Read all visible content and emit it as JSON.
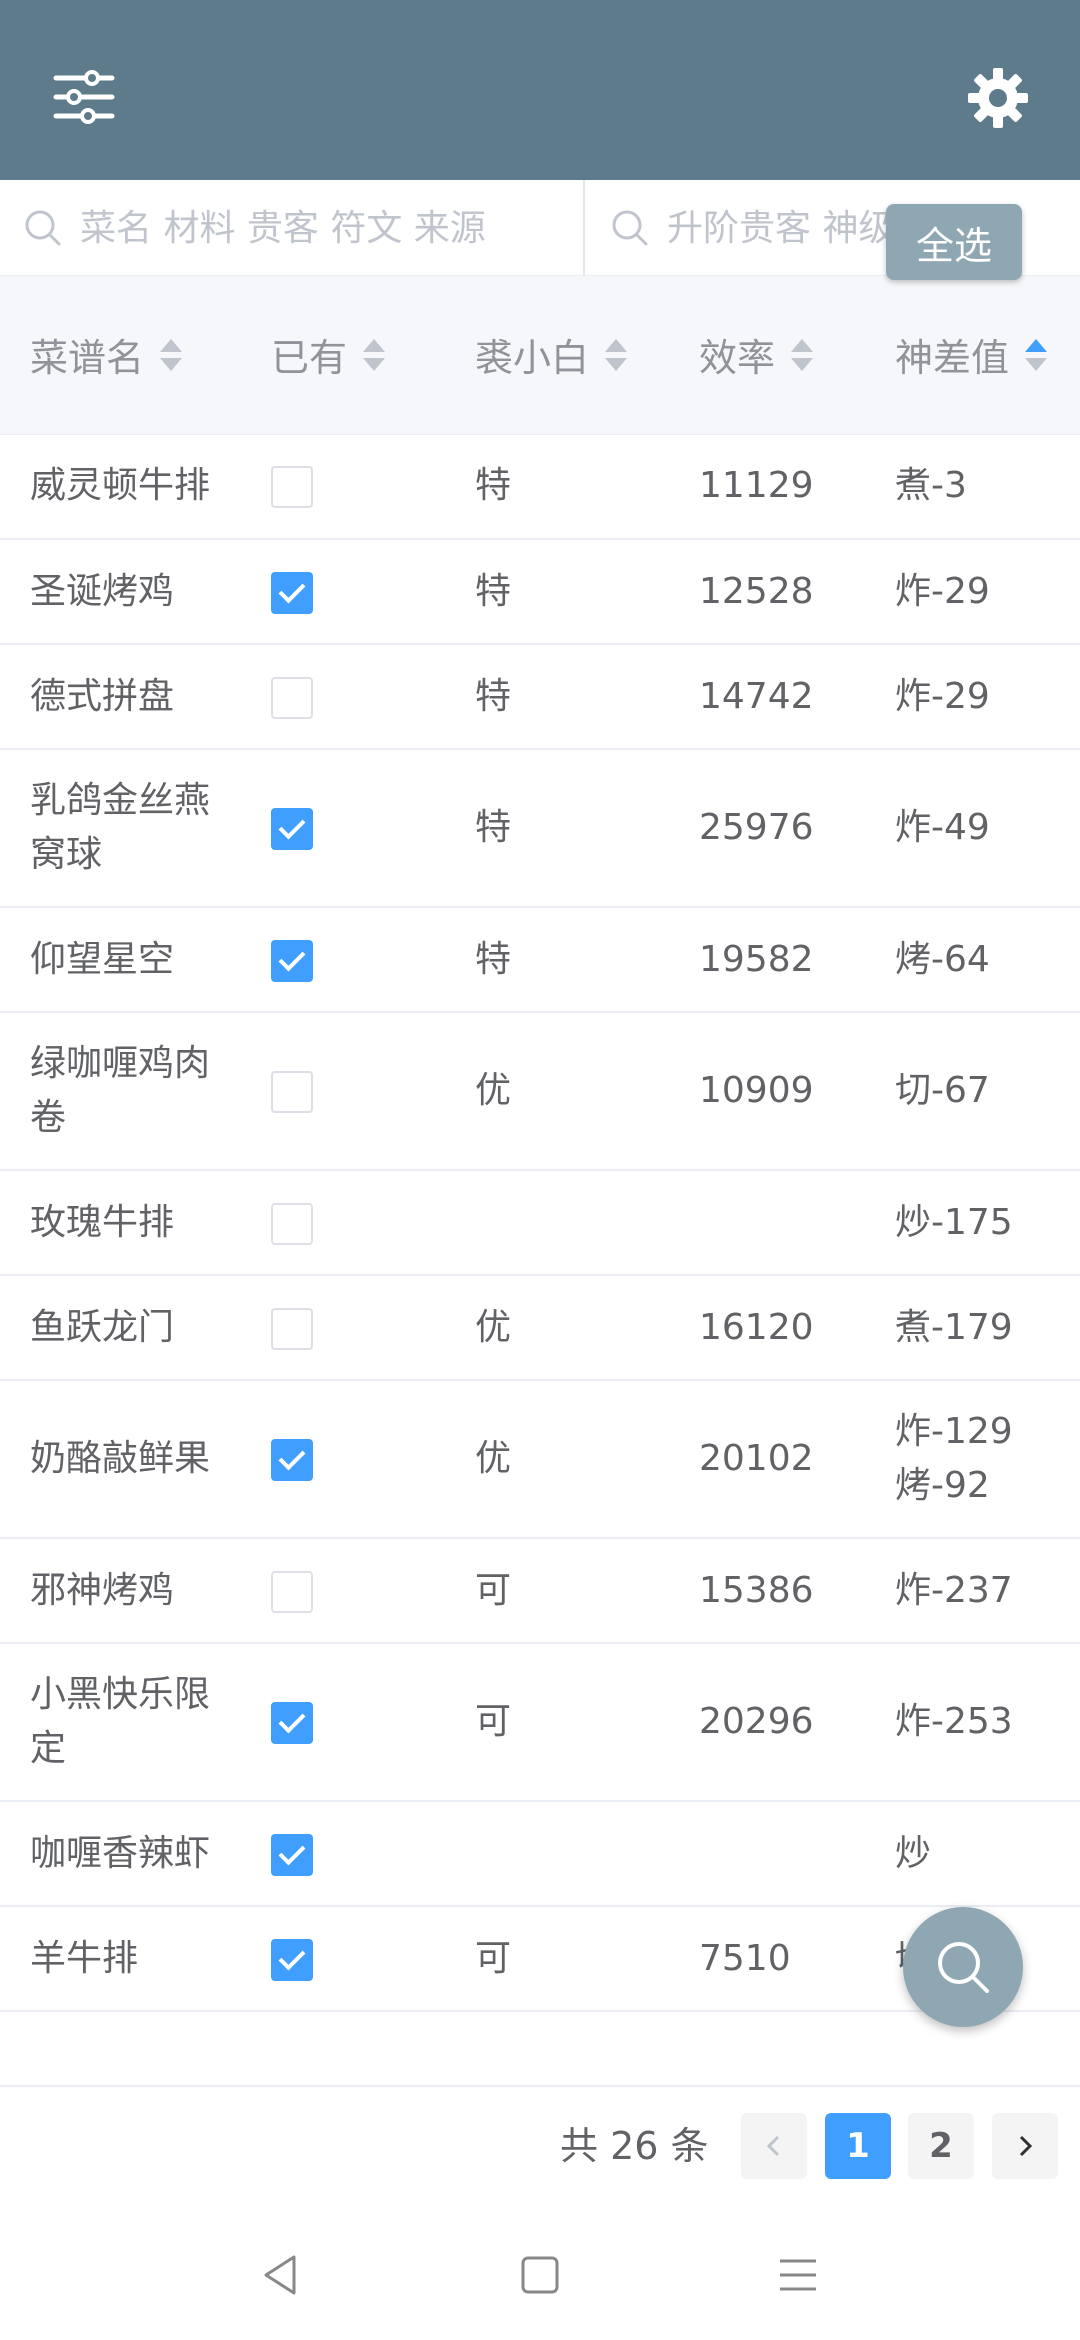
{
  "search": {
    "left_placeholder": "菜名 材料 贵客 符文 来源",
    "right_placeholder": "升阶贵客 神级符文"
  },
  "toolbar": {
    "select_all": "全选"
  },
  "table": {
    "headers": [
      "菜谱名",
      "已有",
      "裘小白",
      "效率",
      "神差值"
    ],
    "sort_active": "神差值",
    "rows": [
      {
        "name": "威灵顿牛排",
        "owned": false,
        "grade": "特",
        "efficiency": "11129",
        "diff": "煮-3"
      },
      {
        "name": "圣诞烤鸡",
        "owned": true,
        "grade": "特",
        "efficiency": "12528",
        "diff": "炸-29"
      },
      {
        "name": "德式拼盘",
        "owned": false,
        "grade": "特",
        "efficiency": "14742",
        "diff": "炸-29"
      },
      {
        "name": "乳鸽金丝燕窝球",
        "owned": true,
        "grade": "特",
        "efficiency": "25976",
        "diff": "炸-49"
      },
      {
        "name": "仰望星空",
        "owned": true,
        "grade": "特",
        "efficiency": "19582",
        "diff": "烤-64"
      },
      {
        "name": "绿咖喱鸡肉卷",
        "owned": false,
        "grade": "优",
        "efficiency": "10909",
        "diff": "切-67"
      },
      {
        "name": "玫瑰牛排",
        "owned": false,
        "grade": "",
        "efficiency": "",
        "diff": "炒-175"
      },
      {
        "name": "鱼跃龙门",
        "owned": false,
        "grade": "优",
        "efficiency": "16120",
        "diff": "煮-179"
      },
      {
        "name": "奶酪敲鲜果",
        "owned": true,
        "grade": "优",
        "efficiency": "20102",
        "diff": "炸-129\n烤-92"
      },
      {
        "name": "邪神烤鸡",
        "owned": false,
        "grade": "可",
        "efficiency": "15386",
        "diff": "炸-237"
      },
      {
        "name": "小黑快乐限定",
        "owned": true,
        "grade": "可",
        "efficiency": "20296",
        "diff": "炸-253"
      },
      {
        "name": "咖喱香辣虾",
        "owned": true,
        "grade": "",
        "efficiency": "",
        "diff": "炒"
      },
      {
        "name": "羊牛排",
        "owned": true,
        "grade": "可",
        "efficiency": "7510",
        "diff": "切-267"
      }
    ]
  },
  "pagination": {
    "total": "共 26 条",
    "pages": [
      "1",
      "2"
    ],
    "current": "1"
  },
  "colors": {
    "header": "#5d7b8a",
    "accent": "#409eff",
    "fab": "#8fa7b3"
  },
  "icons": [
    "filter-menu-icon",
    "gear-icon",
    "search-icon",
    "sort-icon",
    "chevron-left-icon",
    "chevron-right-icon",
    "back-icon",
    "home-icon",
    "recents-icon"
  ]
}
